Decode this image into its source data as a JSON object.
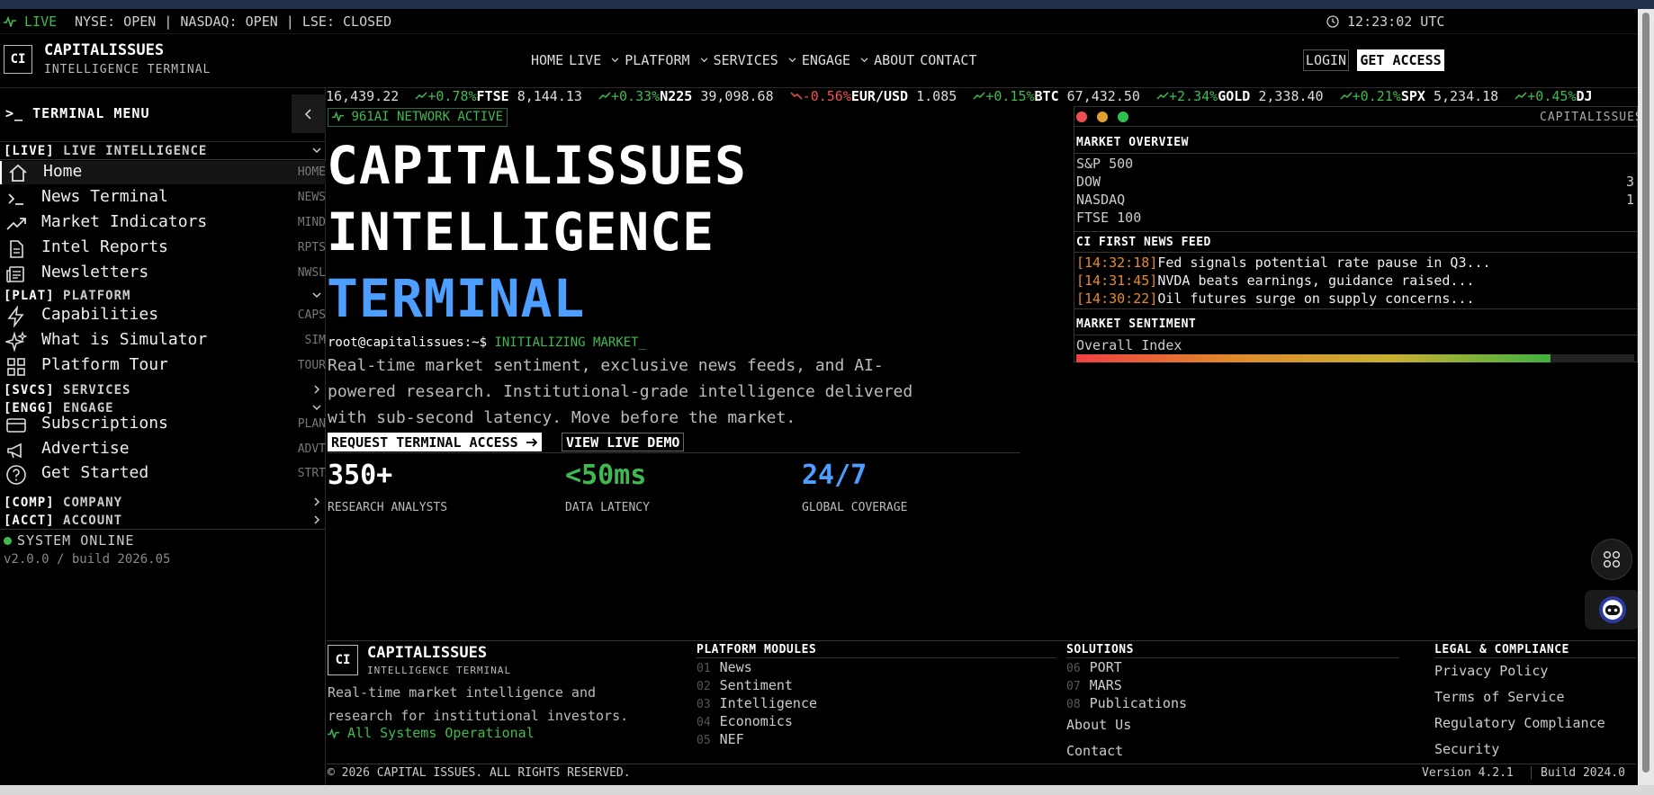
{
  "statusbar": {
    "live": "LIVE",
    "markets": "NYSE: OPEN | NASDAQ: OPEN | LSE: CLOSED",
    "time": "12:23:02 UTC"
  },
  "brand": {
    "logo": "CI",
    "name": "CAPITALISSUES",
    "tagline": "INTELLIGENCE TERMINAL"
  },
  "nav": [
    {
      "label": "HOME",
      "caret": false
    },
    {
      "label": "LIVE",
      "caret": true
    },
    {
      "label": "PLATFORM",
      "caret": true
    },
    {
      "label": "SERVICES",
      "caret": true
    },
    {
      "label": "ENGAGE",
      "caret": true
    },
    {
      "label": "ABOUT",
      "caret": false
    },
    {
      "label": "CONTACT",
      "caret": false
    }
  ],
  "header_buttons": {
    "login": "LOGIN",
    "access": "GET ACCESS"
  },
  "ticker": [
    {
      "name": "",
      "price": "16,439.22",
      "change": "+0.78%",
      "dir": "up"
    },
    {
      "name": "FTSE",
      "price": "8,144.13",
      "change": "+0.33%",
      "dir": "up"
    },
    {
      "name": "N225",
      "price": "39,098.68",
      "change": "-0.56%",
      "dir": "down"
    },
    {
      "name": "EUR/USD",
      "price": "1.085",
      "change": "+0.15%",
      "dir": "up"
    },
    {
      "name": "BTC",
      "price": "67,432.50",
      "change": "+2.34%",
      "dir": "up"
    },
    {
      "name": "GOLD",
      "price": "2,338.40",
      "change": "+0.21%",
      "dir": "up"
    },
    {
      "name": "SPX",
      "price": "5,234.18",
      "change": "+0.45%",
      "dir": "up"
    },
    {
      "name": "DJ",
      "price": "",
      "change": "",
      "dir": "up"
    }
  ],
  "sidebar": {
    "title": ">_ TERMINAL MENU",
    "sections": {
      "live": {
        "tag": "[LIVE]",
        "label": "LIVE INTELLIGENCE"
      },
      "plat": {
        "tag": "[PLAT]",
        "label": "PLATFORM"
      },
      "svcs": {
        "tag": "[SVCS]",
        "label": "SERVICES"
      },
      "engg": {
        "tag": "[ENGG]",
        "label": "ENGAGE"
      },
      "comp": {
        "tag": "[COMP]",
        "label": "COMPANY"
      },
      "acct": {
        "tag": "[ACCT]",
        "label": "ACCOUNT"
      }
    },
    "items": [
      {
        "label": "Home",
        "code": "HOME"
      },
      {
        "label": "News Terminal",
        "code": "NEWS"
      },
      {
        "label": "Market Indicators",
        "code": "MIND"
      },
      {
        "label": "Intel Reports",
        "code": "RPTS"
      },
      {
        "label": "Newsletters",
        "code": "NWSL"
      },
      {
        "label": "Capabilities",
        "code": "CAPS"
      },
      {
        "label": "What is Simulator",
        "code": "SIM"
      },
      {
        "label": "Platform Tour",
        "code": "TOUR"
      },
      {
        "label": "Subscriptions",
        "code": "PLAN"
      },
      {
        "label": "Advertise",
        "code": "ADVT"
      },
      {
        "label": "Get Started",
        "code": "STRT"
      }
    ],
    "status": "SYSTEM ONLINE",
    "version": "v2.0.0 / build 2026.05"
  },
  "hero": {
    "network": "961AI NETWORK ACTIVE",
    "line1": "CAPITALISSUES",
    "line2": "INTELLIGENCE",
    "line3": "TERMINAL",
    "prompt": "root@capitalissues:~$",
    "command": "INITIALIZING MARKET_",
    "para": [
      "Real-time market sentiment, exclusive news feeds, and AI-",
      "powered research. Institutional-grade intelligence delivered",
      "with sub-second latency. Move before the market."
    ],
    "cta_primary": "REQUEST TERMINAL ACCESS",
    "cta_secondary": "VIEW LIVE DEMO",
    "stats": [
      {
        "value": "350+",
        "label": "RESEARCH ANALYSTS",
        "color": "#ffffff"
      },
      {
        "value": "<50ms",
        "label": "DATA LATENCY",
        "color": "#3fba50"
      },
      {
        "value": "24/7",
        "label": "GLOBAL COVERAGE",
        "color": "#4d9eff"
      }
    ]
  },
  "window": {
    "title": "CAPITALISSUES",
    "overview_title": "MARKET OVERVIEW",
    "overview": [
      {
        "name": "S&P 500",
        "value": ""
      },
      {
        "name": "DOW",
        "value": "3"
      },
      {
        "name": "NASDAQ",
        "value": "1"
      },
      {
        "name": "FTSE 100",
        "value": ""
      }
    ],
    "news_title": "CI FIRST NEWS FEED",
    "news": [
      {
        "time": "[14:32:18]",
        "text": "Fed signals potential rate pause in Q3..."
      },
      {
        "time": "[14:31:45]",
        "text": "NVDA beats earnings, guidance raised..."
      },
      {
        "time": "[14:30:22]",
        "text": "Oil futures surge on supply concerns..."
      }
    ],
    "sentiment_title": "MARKET SENTIMENT",
    "sentiment_label": "Overall Index",
    "sentiment_level": 0.85
  },
  "footer": {
    "brand_desc": [
      "Real-time market intelligence and",
      "research for institutional investors."
    ],
    "system": "All Systems Operational",
    "modules_title": "PLATFORM MODULES",
    "modules": [
      {
        "num": "01",
        "label": "News"
      },
      {
        "num": "02",
        "label": "Sentiment"
      },
      {
        "num": "03",
        "label": "Intelligence"
      },
      {
        "num": "04",
        "label": "Economics"
      },
      {
        "num": "05",
        "label": "NEF"
      }
    ],
    "solutions_title": "SOLUTIONS",
    "solutions": [
      {
        "num": "06",
        "label": "PORT"
      },
      {
        "num": "07",
        "label": "MARS"
      },
      {
        "num": "08",
        "label": "Publications"
      }
    ],
    "about": "About Us",
    "contact": "Contact",
    "legal_title": "LEGAL & COMPLIANCE",
    "legal": [
      "Privacy Policy",
      "Terms of Service",
      "Regulatory Compliance",
      "Security"
    ],
    "copyright": "© 2026 CAPITAL ISSUES. ALL RIGHTS RESERVED.",
    "version": "Version 4.2.1",
    "build": "Build 2024.0"
  },
  "colors": {
    "accent_blue": "#4d9eff",
    "green": "#3fba50",
    "red": "#f05050",
    "orange": "#e88a2a"
  }
}
